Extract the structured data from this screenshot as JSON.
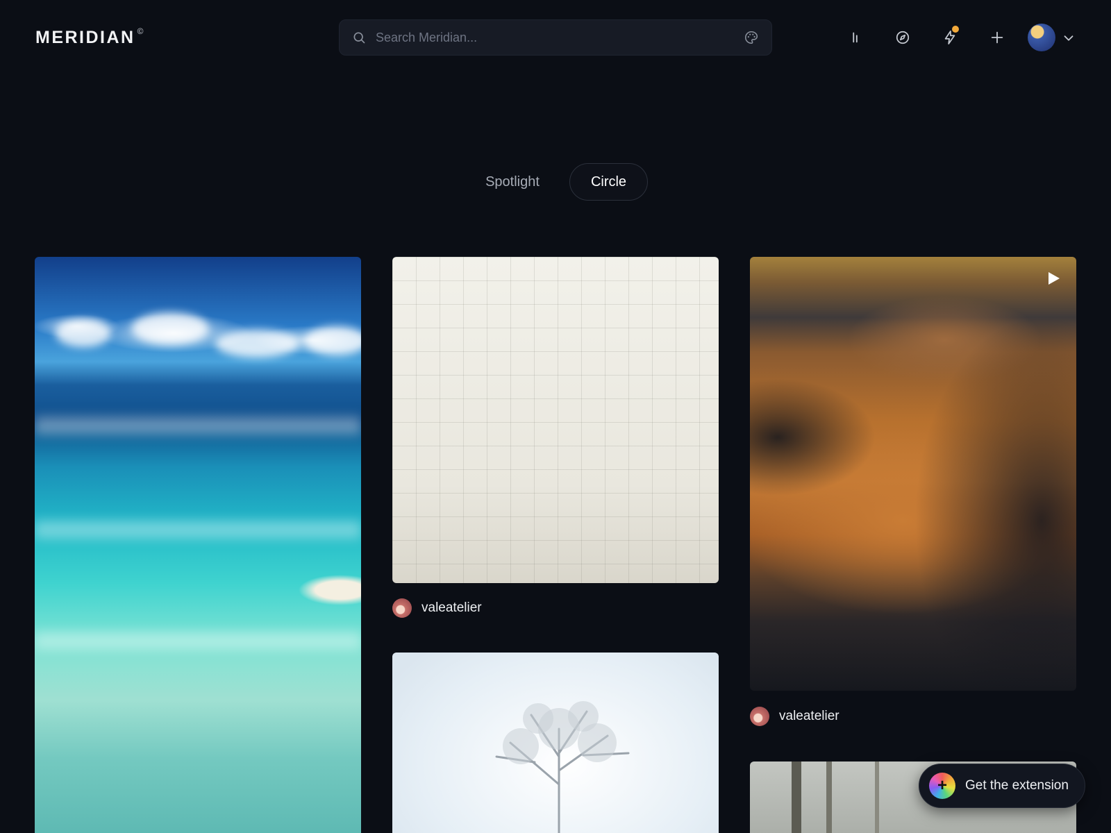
{
  "app": {
    "logo_text": "MERIDIAN",
    "logo_mark": "©"
  },
  "search": {
    "placeholder": "Search Meridian...",
    "value": ""
  },
  "header_icons": [
    "stats-icon",
    "compass-icon",
    "lightning-icon",
    "plus-icon"
  ],
  "colors": {
    "background": "#0b0e15",
    "notification": "#f2a93b",
    "surface": "#171b25"
  },
  "tabs": [
    {
      "label": "Spotlight",
      "active": false
    },
    {
      "label": "Circle",
      "active": true
    }
  ],
  "feed": {
    "posts": [
      {
        "image": "tropical ocean aerial",
        "author": ""
      },
      {
        "image": "grid paper",
        "author": "valeatelier"
      },
      {
        "image": "sand dunes",
        "author": "valeatelier",
        "media": "video"
      },
      {
        "image": "frosted tree",
        "author": ""
      },
      {
        "image": "foggy forest",
        "author": ""
      }
    ]
  },
  "extension": {
    "label": "Get the extension",
    "glyph": "+"
  }
}
